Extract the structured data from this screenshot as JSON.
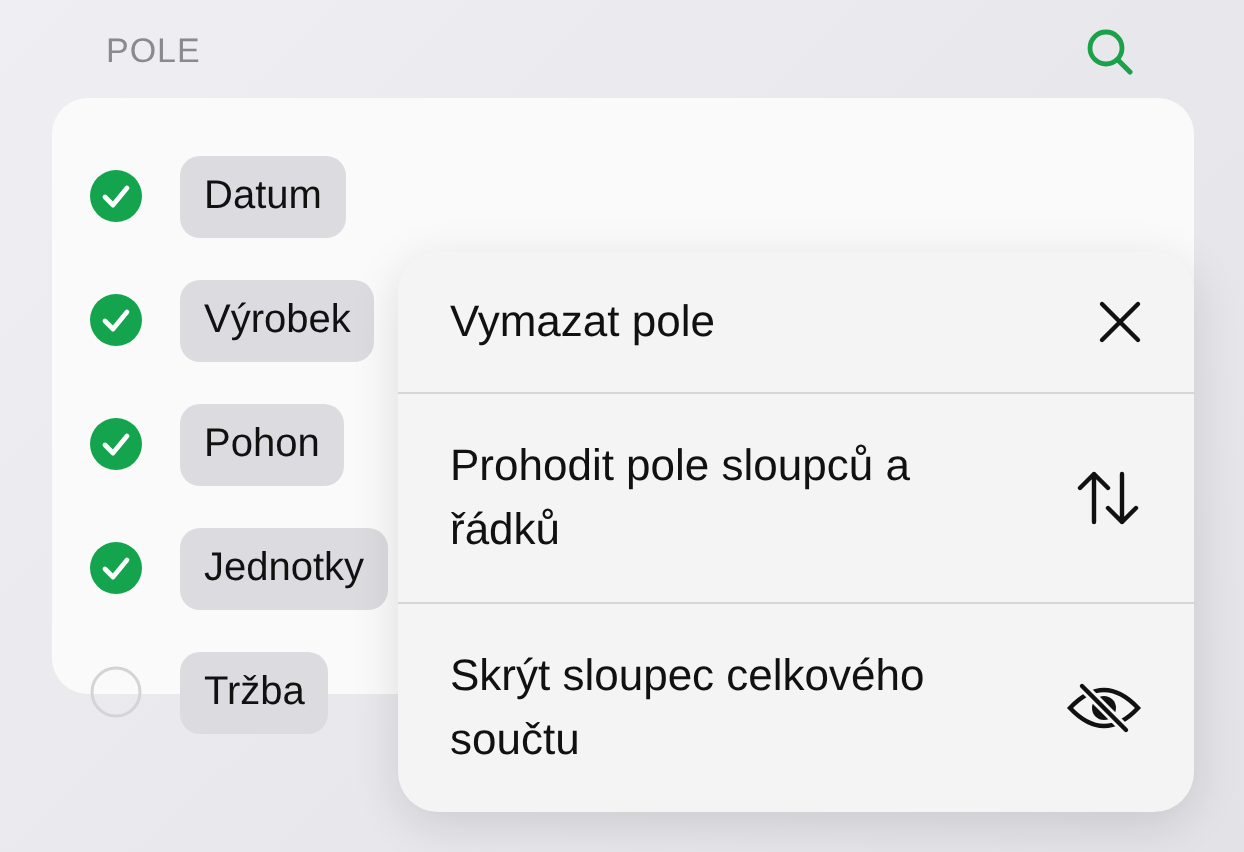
{
  "header": {
    "title": "POLE"
  },
  "fields": [
    {
      "label": "Datum",
      "checked": true
    },
    {
      "label": "Výrobek",
      "checked": true
    },
    {
      "label": "Pohon",
      "checked": true
    },
    {
      "label": "Jednotky",
      "checked": true
    },
    {
      "label": "Tržba",
      "checked": false
    }
  ],
  "menu": [
    {
      "label": "Vymazat pole",
      "kind": "clear"
    },
    {
      "label": "Prohodit pole sloupců a řádků",
      "kind": "swap"
    },
    {
      "label": "Skrýt sloupec celkového součtu",
      "kind": "hide"
    }
  ]
}
